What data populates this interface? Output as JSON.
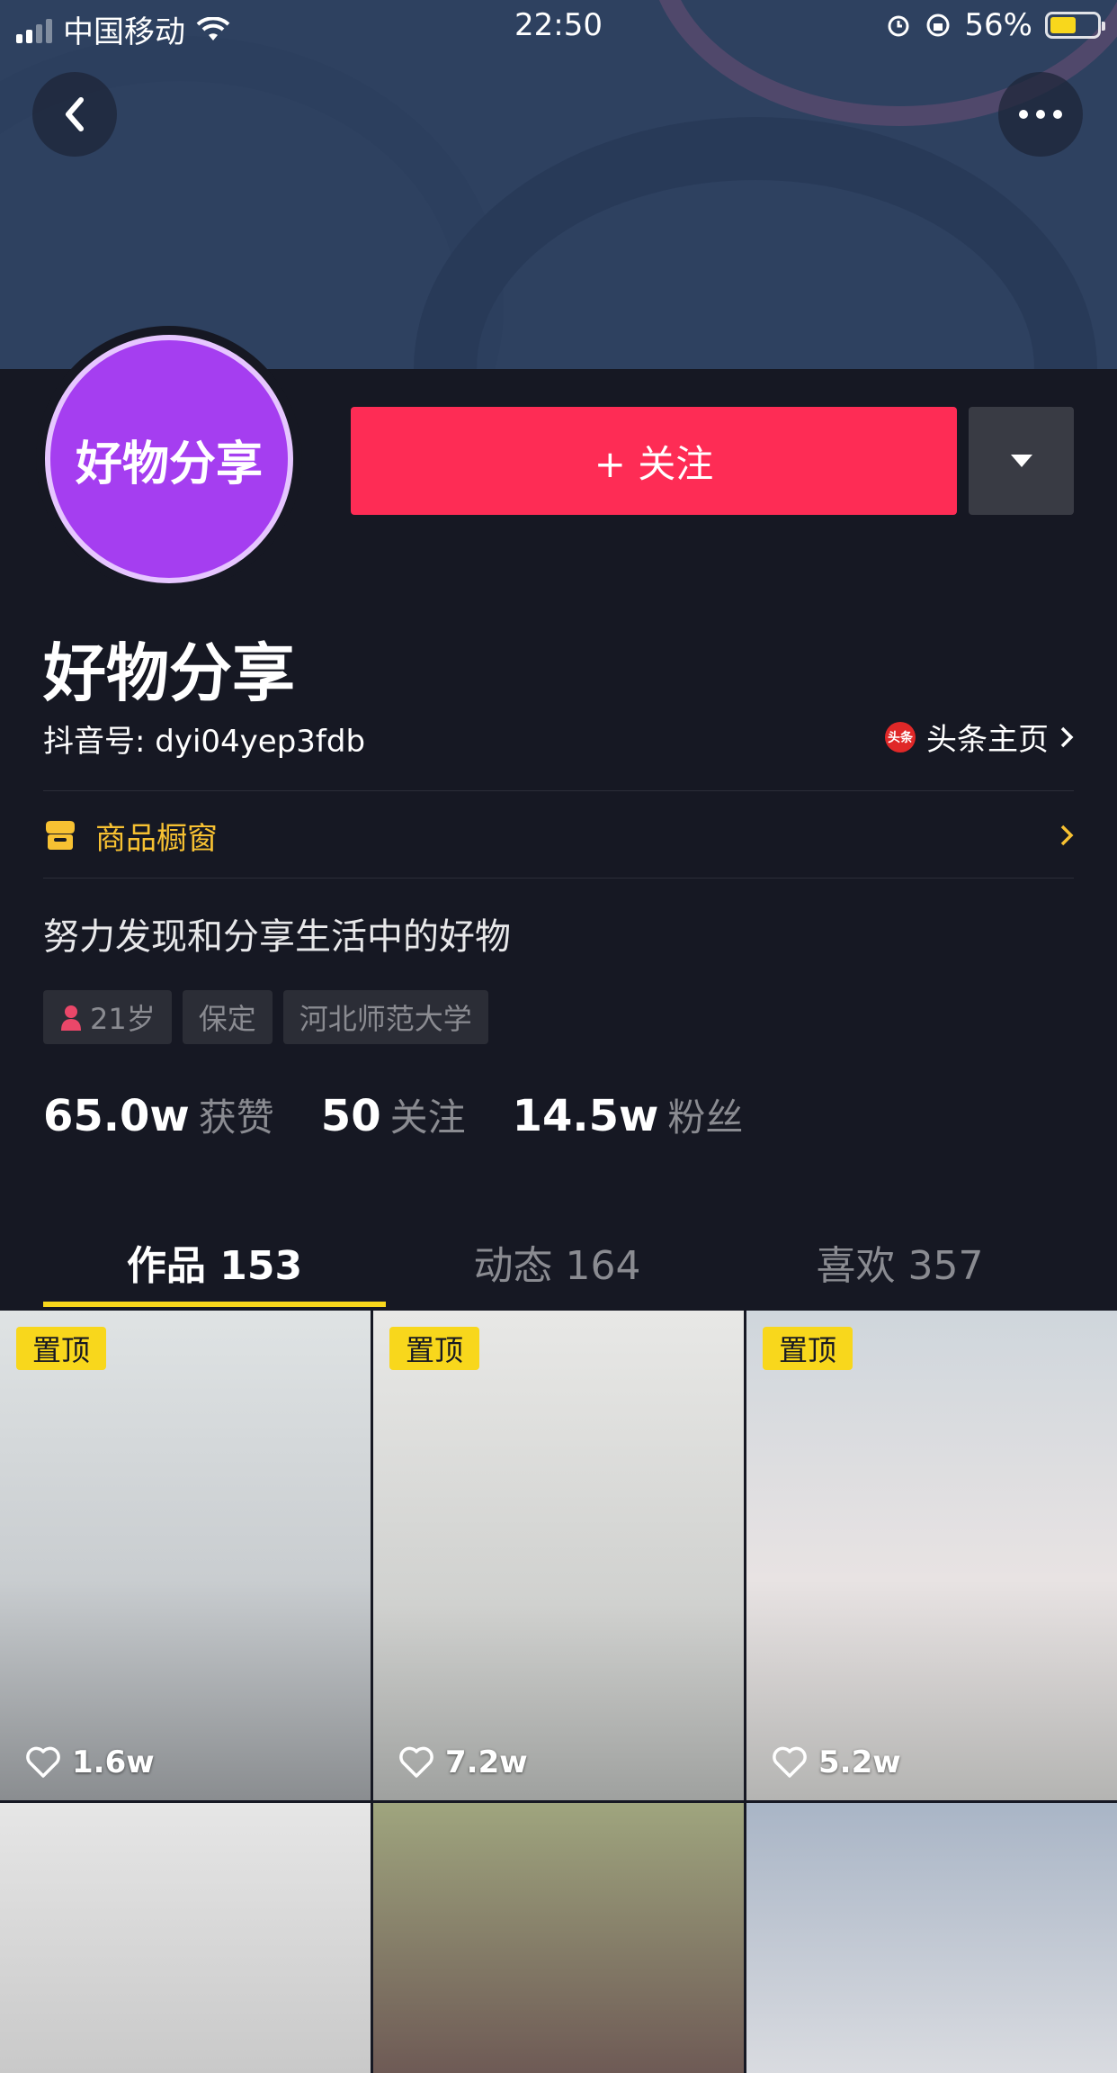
{
  "status_bar": {
    "carrier": "中国移动",
    "time": "22:50",
    "battery": "56%"
  },
  "profile": {
    "avatar_text": "好物分享",
    "follow_label": "+ 关注",
    "name": "好物分享",
    "douyin_id": "抖音号: dyi04yep3fdb",
    "toutiao_badge": "头条",
    "toutiao_label": "头条主页",
    "shop_label": "商品橱窗",
    "bio": "努力发现和分享生活中的好物",
    "tags": {
      "age": "21岁",
      "city": "保定",
      "school": "河北师范大学"
    },
    "stats": [
      {
        "num": "65.0w",
        "label": "获赞"
      },
      {
        "num": "50",
        "label": "关注"
      },
      {
        "num": "14.5w",
        "label": "粉丝"
      }
    ]
  },
  "tabs": [
    {
      "label": "作品 153"
    },
    {
      "label": "动态 164"
    },
    {
      "label": "喜欢 357"
    }
  ],
  "videos": [
    {
      "pin": "置顶",
      "likes": "1.6w"
    },
    {
      "pin": "置顶",
      "likes": "7.2w"
    },
    {
      "pin": "置顶",
      "likes": "5.2w"
    }
  ],
  "colors": {
    "accent": "#fe2c55",
    "highlight": "#f8d71c",
    "background": "#161823"
  }
}
